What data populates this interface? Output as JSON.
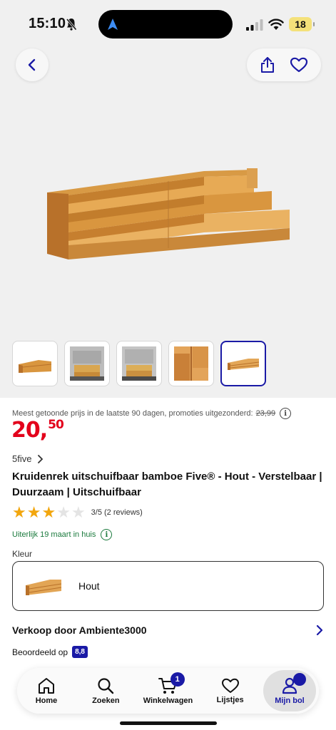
{
  "status_bar": {
    "time": "15:10",
    "battery": "18"
  },
  "nav": {
    "back_icon": "chevron-left-icon",
    "share_icon": "share-icon",
    "wishlist_icon": "heart-icon"
  },
  "gallery": {
    "main_image": "bamboo-spice-rack-image",
    "thumbnails": [
      {
        "name": "thumb-rack-front",
        "active": false
      },
      {
        "name": "thumb-rack-in-cabinet-1",
        "active": false
      },
      {
        "name": "thumb-rack-in-cabinet-2",
        "active": false
      },
      {
        "name": "thumb-rack-detail",
        "active": false
      },
      {
        "name": "thumb-rack-angled",
        "active": true
      }
    ]
  },
  "product": {
    "price_note": "Meest getoonde prijs in de laatste 90 dagen, promoties uitgezonderd:",
    "old_price": "23,99",
    "price_euros": "20,",
    "price_cents": "50",
    "brand": "5five",
    "title": "Kruidenrek uitschuifbaar bamboe Five® - Hout - Verstelbaar | Duurzaam | Uitschuifbaar",
    "rating_value": 3,
    "rating_max": 5,
    "rating_text": "3/5 (2 reviews)",
    "delivery": "Uiterlijk 19 maart in huis",
    "color_label": "Kleur",
    "color_value": "Hout",
    "seller_label": "Verkoop door Ambiente3000",
    "rated_label": "Beoordeeld op",
    "seller_score": "8,8"
  },
  "tabs": [
    {
      "label": "Home",
      "icon": "home-icon"
    },
    {
      "label": "Zoeken",
      "icon": "search-icon"
    },
    {
      "label": "Winkelwagen",
      "icon": "cart-icon",
      "badge": "1"
    },
    {
      "label": "Lijstjes",
      "icon": "heart-icon"
    },
    {
      "label": "Mijn bol",
      "icon": "user-icon",
      "active": true
    }
  ],
  "colors": {
    "accent": "#1a1aa6",
    "price": "#e3001b",
    "delivery": "#1b7a3d",
    "star": "#f2a60d"
  }
}
